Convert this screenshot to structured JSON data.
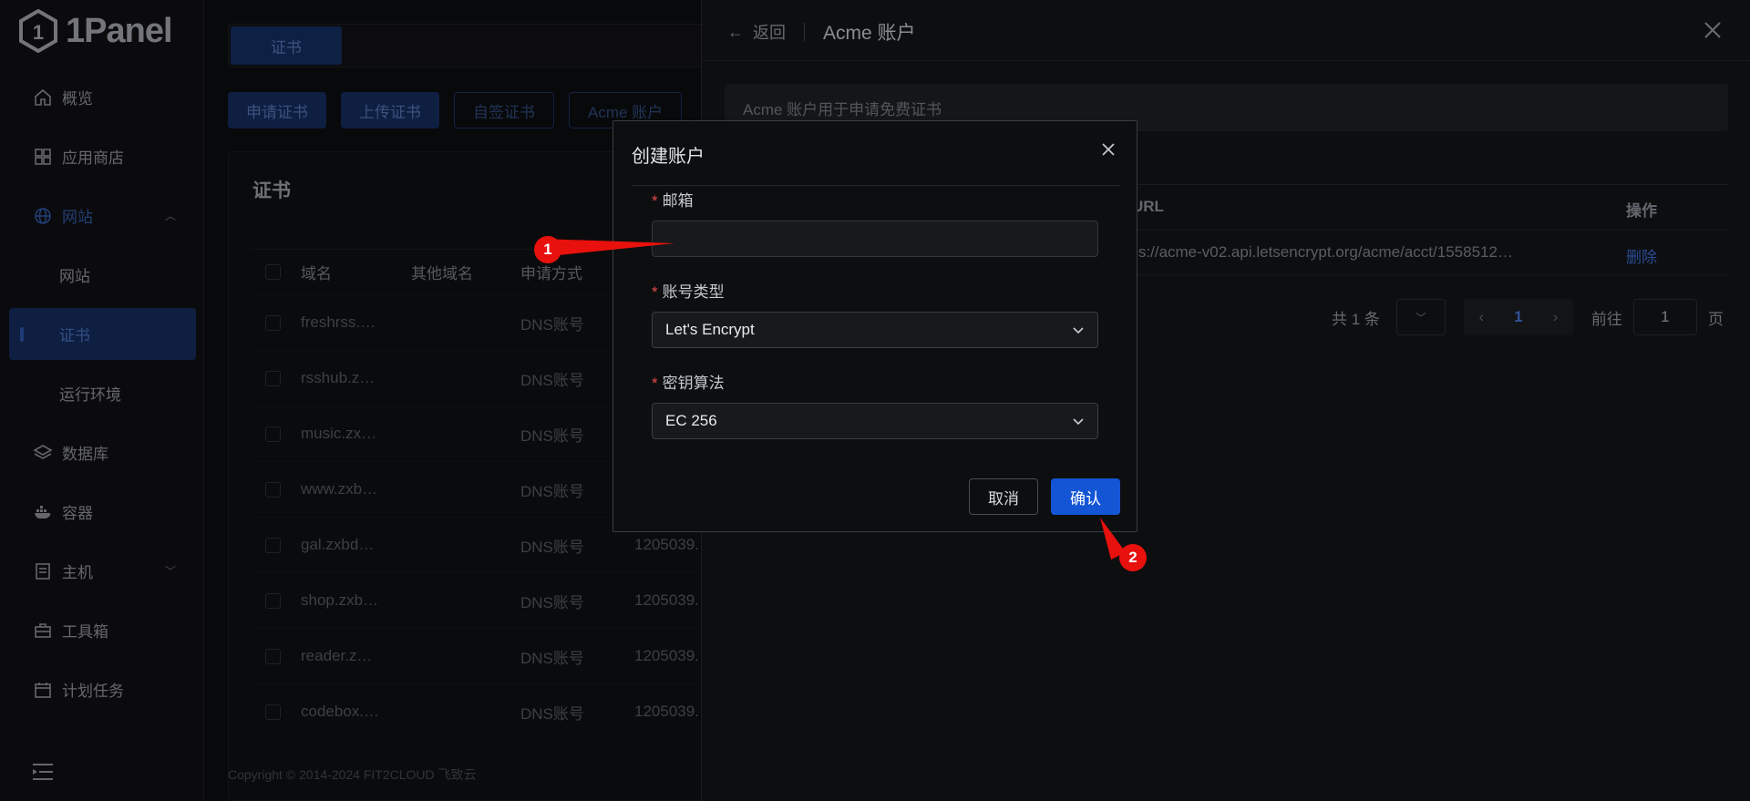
{
  "app": {
    "logo_text": "1Panel",
    "copyright": "Copyright © 2014-2024 FIT2CLOUD 飞致云"
  },
  "sidebar": {
    "items": [
      {
        "label": "概览",
        "icon": "home-icon"
      },
      {
        "label": "应用商店",
        "icon": "grid-icon"
      },
      {
        "label": "网站",
        "icon": "globe-icon",
        "state": "open"
      },
      {
        "label": "网站",
        "sub": true
      },
      {
        "label": "证书",
        "sub": true,
        "state": "active"
      },
      {
        "label": "运行环境",
        "sub": true
      },
      {
        "label": "数据库",
        "icon": "layers-icon"
      },
      {
        "label": "容器",
        "icon": "docker-icon"
      },
      {
        "label": "主机",
        "icon": "server-icon"
      },
      {
        "label": "工具箱",
        "icon": "toolbox-icon"
      },
      {
        "label": "计划任务",
        "icon": "calendar-icon"
      }
    ]
  },
  "main": {
    "tab": "证书",
    "buttons": {
      "apply": "申请证书",
      "upload": "上传证书",
      "self_sign": "自签证书",
      "acme": "Acme 账户"
    },
    "card_title": "证书",
    "columns": {
      "domain": "域名",
      "other": "其他域名",
      "type": "申请方式"
    },
    "rows": [
      {
        "domain": "freshrss.…",
        "type": "DNS账号",
        "id": ""
      },
      {
        "domain": "rsshub.z…",
        "type": "DNS账号",
        "id": ""
      },
      {
        "domain": "music.zx…",
        "type": "DNS账号",
        "id": ""
      },
      {
        "domain": "www.zxb…",
        "type": "DNS账号",
        "id": ""
      },
      {
        "domain": "gal.zxbd…",
        "type": "DNS账号",
        "id": "1205039."
      },
      {
        "domain": "shop.zxb…",
        "type": "DNS账号",
        "id": "1205039."
      },
      {
        "domain": "reader.z…",
        "type": "DNS账号",
        "id": "1205039."
      },
      {
        "domain": "codebox.…",
        "type": "DNS账号",
        "id": "1205039."
      }
    ]
  },
  "drawer": {
    "back": "返回",
    "title": "Acme 账户",
    "note": "Acme 账户用于申请免费证书",
    "col_url": "URL",
    "col_op": "操作",
    "row_url": "ttps://acme-v02.api.letsencrypt.org/acme/acct/1558512…",
    "row_delete": "删除",
    "pager": {
      "total": "共 1 条",
      "current": "1",
      "goto": "前往",
      "goto_value": "1",
      "page_unit": "页"
    }
  },
  "dialog": {
    "title": "创建账户",
    "email_label": "邮箱",
    "email_value": "",
    "account_type_label": "账号类型",
    "account_type_value": "Let's Encrypt",
    "key_algo_label": "密钥算法",
    "key_algo_value": "EC 256",
    "cancel": "取消",
    "confirm": "确认"
  },
  "annotations": {
    "step1": "1",
    "step2": "2",
    "color": "#e8110d"
  }
}
